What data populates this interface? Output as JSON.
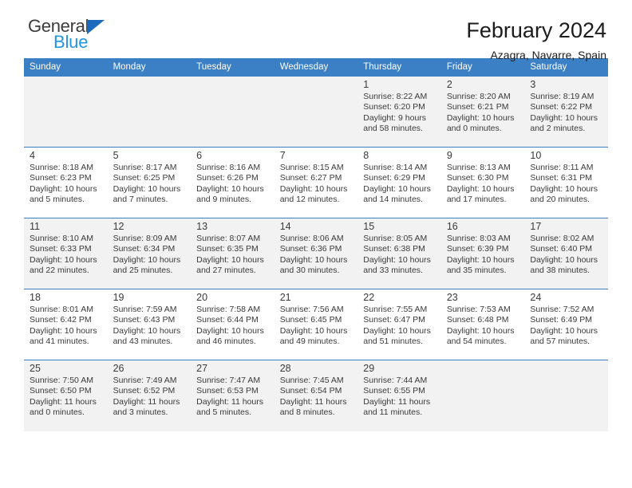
{
  "brand": {
    "word1": "General",
    "word2": "Blue",
    "triangle_color": "#1a6bbd",
    "blue_color": "#2196e3"
  },
  "header": {
    "title": "February 2024",
    "subtitle": "Azagra, Navarre, Spain"
  },
  "theme": {
    "header_blue": "#3b7fc4",
    "row_shade": "#f2f2f2"
  },
  "weekdays": [
    "Sunday",
    "Monday",
    "Tuesday",
    "Wednesday",
    "Thursday",
    "Friday",
    "Saturday"
  ],
  "weeks": [
    {
      "shaded": true,
      "days": [
        {
          "num": "",
          "sunrise": "",
          "sunset": "",
          "daylight1": "",
          "daylight2": ""
        },
        {
          "num": "",
          "sunrise": "",
          "sunset": "",
          "daylight1": "",
          "daylight2": ""
        },
        {
          "num": "",
          "sunrise": "",
          "sunset": "",
          "daylight1": "",
          "daylight2": ""
        },
        {
          "num": "",
          "sunrise": "",
          "sunset": "",
          "daylight1": "",
          "daylight2": ""
        },
        {
          "num": "1",
          "sunrise": "Sunrise: 8:22 AM",
          "sunset": "Sunset: 6:20 PM",
          "daylight1": "Daylight: 9 hours",
          "daylight2": "and 58 minutes."
        },
        {
          "num": "2",
          "sunrise": "Sunrise: 8:20 AM",
          "sunset": "Sunset: 6:21 PM",
          "daylight1": "Daylight: 10 hours",
          "daylight2": "and 0 minutes."
        },
        {
          "num": "3",
          "sunrise": "Sunrise: 8:19 AM",
          "sunset": "Sunset: 6:22 PM",
          "daylight1": "Daylight: 10 hours",
          "daylight2": "and 2 minutes."
        }
      ]
    },
    {
      "shaded": false,
      "days": [
        {
          "num": "4",
          "sunrise": "Sunrise: 8:18 AM",
          "sunset": "Sunset: 6:23 PM",
          "daylight1": "Daylight: 10 hours",
          "daylight2": "and 5 minutes."
        },
        {
          "num": "5",
          "sunrise": "Sunrise: 8:17 AM",
          "sunset": "Sunset: 6:25 PM",
          "daylight1": "Daylight: 10 hours",
          "daylight2": "and 7 minutes."
        },
        {
          "num": "6",
          "sunrise": "Sunrise: 8:16 AM",
          "sunset": "Sunset: 6:26 PM",
          "daylight1": "Daylight: 10 hours",
          "daylight2": "and 9 minutes."
        },
        {
          "num": "7",
          "sunrise": "Sunrise: 8:15 AM",
          "sunset": "Sunset: 6:27 PM",
          "daylight1": "Daylight: 10 hours",
          "daylight2": "and 12 minutes."
        },
        {
          "num": "8",
          "sunrise": "Sunrise: 8:14 AM",
          "sunset": "Sunset: 6:29 PM",
          "daylight1": "Daylight: 10 hours",
          "daylight2": "and 14 minutes."
        },
        {
          "num": "9",
          "sunrise": "Sunrise: 8:13 AM",
          "sunset": "Sunset: 6:30 PM",
          "daylight1": "Daylight: 10 hours",
          "daylight2": "and 17 minutes."
        },
        {
          "num": "10",
          "sunrise": "Sunrise: 8:11 AM",
          "sunset": "Sunset: 6:31 PM",
          "daylight1": "Daylight: 10 hours",
          "daylight2": "and 20 minutes."
        }
      ]
    },
    {
      "shaded": true,
      "days": [
        {
          "num": "11",
          "sunrise": "Sunrise: 8:10 AM",
          "sunset": "Sunset: 6:33 PM",
          "daylight1": "Daylight: 10 hours",
          "daylight2": "and 22 minutes."
        },
        {
          "num": "12",
          "sunrise": "Sunrise: 8:09 AM",
          "sunset": "Sunset: 6:34 PM",
          "daylight1": "Daylight: 10 hours",
          "daylight2": "and 25 minutes."
        },
        {
          "num": "13",
          "sunrise": "Sunrise: 8:07 AM",
          "sunset": "Sunset: 6:35 PM",
          "daylight1": "Daylight: 10 hours",
          "daylight2": "and 27 minutes."
        },
        {
          "num": "14",
          "sunrise": "Sunrise: 8:06 AM",
          "sunset": "Sunset: 6:36 PM",
          "daylight1": "Daylight: 10 hours",
          "daylight2": "and 30 minutes."
        },
        {
          "num": "15",
          "sunrise": "Sunrise: 8:05 AM",
          "sunset": "Sunset: 6:38 PM",
          "daylight1": "Daylight: 10 hours",
          "daylight2": "and 33 minutes."
        },
        {
          "num": "16",
          "sunrise": "Sunrise: 8:03 AM",
          "sunset": "Sunset: 6:39 PM",
          "daylight1": "Daylight: 10 hours",
          "daylight2": "and 35 minutes."
        },
        {
          "num": "17",
          "sunrise": "Sunrise: 8:02 AM",
          "sunset": "Sunset: 6:40 PM",
          "daylight1": "Daylight: 10 hours",
          "daylight2": "and 38 minutes."
        }
      ]
    },
    {
      "shaded": false,
      "days": [
        {
          "num": "18",
          "sunrise": "Sunrise: 8:01 AM",
          "sunset": "Sunset: 6:42 PM",
          "daylight1": "Daylight: 10 hours",
          "daylight2": "and 41 minutes."
        },
        {
          "num": "19",
          "sunrise": "Sunrise: 7:59 AM",
          "sunset": "Sunset: 6:43 PM",
          "daylight1": "Daylight: 10 hours",
          "daylight2": "and 43 minutes."
        },
        {
          "num": "20",
          "sunrise": "Sunrise: 7:58 AM",
          "sunset": "Sunset: 6:44 PM",
          "daylight1": "Daylight: 10 hours",
          "daylight2": "and 46 minutes."
        },
        {
          "num": "21",
          "sunrise": "Sunrise: 7:56 AM",
          "sunset": "Sunset: 6:45 PM",
          "daylight1": "Daylight: 10 hours",
          "daylight2": "and 49 minutes."
        },
        {
          "num": "22",
          "sunrise": "Sunrise: 7:55 AM",
          "sunset": "Sunset: 6:47 PM",
          "daylight1": "Daylight: 10 hours",
          "daylight2": "and 51 minutes."
        },
        {
          "num": "23",
          "sunrise": "Sunrise: 7:53 AM",
          "sunset": "Sunset: 6:48 PM",
          "daylight1": "Daylight: 10 hours",
          "daylight2": "and 54 minutes."
        },
        {
          "num": "24",
          "sunrise": "Sunrise: 7:52 AM",
          "sunset": "Sunset: 6:49 PM",
          "daylight1": "Daylight: 10 hours",
          "daylight2": "and 57 minutes."
        }
      ]
    },
    {
      "shaded": true,
      "days": [
        {
          "num": "25",
          "sunrise": "Sunrise: 7:50 AM",
          "sunset": "Sunset: 6:50 PM",
          "daylight1": "Daylight: 11 hours",
          "daylight2": "and 0 minutes."
        },
        {
          "num": "26",
          "sunrise": "Sunrise: 7:49 AM",
          "sunset": "Sunset: 6:52 PM",
          "daylight1": "Daylight: 11 hours",
          "daylight2": "and 3 minutes."
        },
        {
          "num": "27",
          "sunrise": "Sunrise: 7:47 AM",
          "sunset": "Sunset: 6:53 PM",
          "daylight1": "Daylight: 11 hours",
          "daylight2": "and 5 minutes."
        },
        {
          "num": "28",
          "sunrise": "Sunrise: 7:45 AM",
          "sunset": "Sunset: 6:54 PM",
          "daylight1": "Daylight: 11 hours",
          "daylight2": "and 8 minutes."
        },
        {
          "num": "29",
          "sunrise": "Sunrise: 7:44 AM",
          "sunset": "Sunset: 6:55 PM",
          "daylight1": "Daylight: 11 hours",
          "daylight2": "and 11 minutes."
        },
        {
          "num": "",
          "sunrise": "",
          "sunset": "",
          "daylight1": "",
          "daylight2": ""
        },
        {
          "num": "",
          "sunrise": "",
          "sunset": "",
          "daylight1": "",
          "daylight2": ""
        }
      ]
    }
  ]
}
